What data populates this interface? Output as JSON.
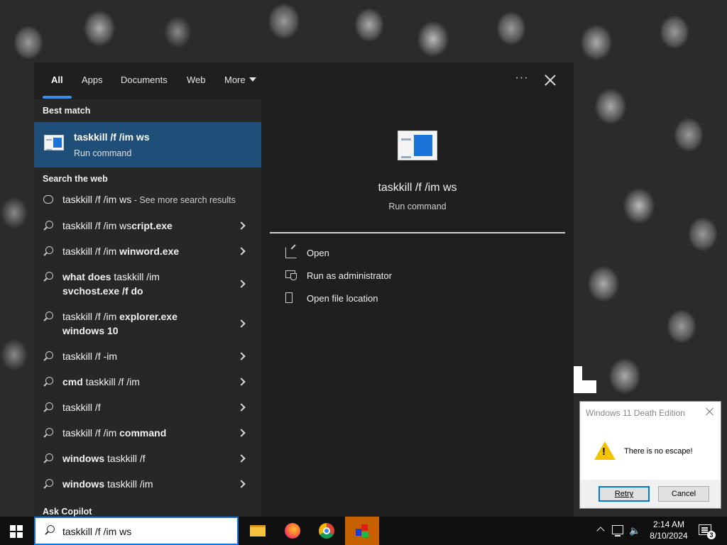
{
  "search": {
    "tabs": [
      {
        "label": "All",
        "active": true
      },
      {
        "label": "Apps"
      },
      {
        "label": "Documents"
      },
      {
        "label": "Web"
      },
      {
        "label": "More"
      }
    ],
    "more_icon": "ellipsis-icon",
    "close_icon": "close-icon",
    "best_match_header": "Best match",
    "best_match": {
      "title": "taskkill /f /im ws",
      "subtitle": "Run command"
    },
    "web_header": "Search the web",
    "web_results": [
      {
        "pre": "taskkill /f /im ws",
        "bold": "",
        "post": "",
        "suffix": " - See more search results",
        "icon": "chat-icon"
      },
      {
        "pre": "taskkill /f /im ws",
        "bold": "cript.exe",
        "post": "",
        "icon": "search-icon"
      },
      {
        "pre": "taskkill /f /im ",
        "bold": "winword.exe",
        "post": "",
        "icon": "search-icon"
      },
      {
        "pre": "",
        "bold": "what does",
        "post": " taskkill /im",
        "line2_bold": "svchost.exe /f do",
        "icon": "search-icon"
      },
      {
        "pre": "taskkill /f /im ",
        "bold": "explorer.exe",
        "post": "",
        "line2_bold": "windows 10",
        "icon": "search-icon"
      },
      {
        "pre": "taskkill /f -im",
        "bold": "",
        "post": "",
        "icon": "search-icon"
      },
      {
        "pre": "",
        "bold": "cmd",
        "post": " taskkill /f /im",
        "icon": "search-icon"
      },
      {
        "pre": "taskkill /f",
        "bold": "",
        "post": "",
        "icon": "search-icon"
      },
      {
        "pre": "taskkill /f /im ",
        "bold": "command",
        "post": "",
        "icon": "search-icon"
      },
      {
        "pre": "",
        "bold": "windows",
        "post": " taskkill /f",
        "icon": "search-icon"
      },
      {
        "pre": "",
        "bold": "windows",
        "post": " taskkill /im",
        "icon": "search-icon"
      }
    ],
    "copilot_header": "Ask Copilot",
    "preview": {
      "title": "taskkill /f /im ws",
      "subtitle": "Run command",
      "actions": [
        {
          "label": "Open",
          "icon": "open-icon"
        },
        {
          "label": "Run as administrator",
          "icon": "shield-icon"
        },
        {
          "label": "Open file location",
          "icon": "folder-icon"
        }
      ]
    }
  },
  "taskbar": {
    "search_value": "taskkill /f /im ws",
    "apps": [
      "file-explorer-icon",
      "firefox-icon",
      "chrome-icon",
      "custom-app-icon"
    ],
    "time": "2:14 AM",
    "date": "8/10/2024",
    "notification_count": "3"
  },
  "dialog": {
    "title": "Windows 11 Death Edition",
    "message": "There is no escape!",
    "retry_label": "Retry",
    "cancel_label": "Cancel"
  },
  "colors": {
    "accent": "#1a73d9",
    "selection": "#1f4e79",
    "active_app": "#c56100"
  }
}
